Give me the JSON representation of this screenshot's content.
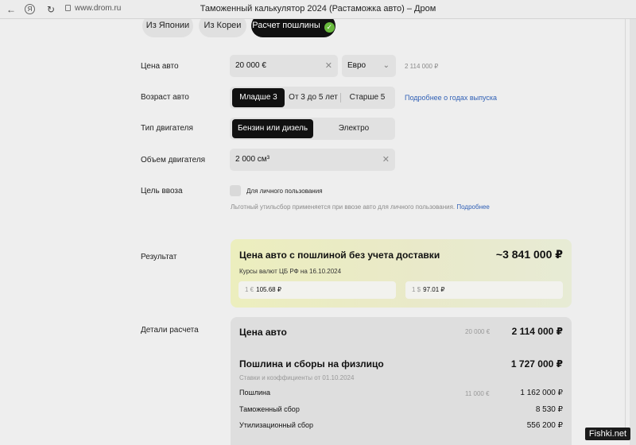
{
  "browser": {
    "url": "www.drom.ru",
    "title": "Таможенный калькулятор 2024 (Растаможка авто) – Дром"
  },
  "tabs": [
    {
      "label": "Из Японии"
    },
    {
      "label": "Из Кореи"
    },
    {
      "label": "Расчет пошлины"
    }
  ],
  "price": {
    "label": "Цена авто",
    "value": "20 000 €",
    "currency": "Евро",
    "converted": "2 114 000 ₽"
  },
  "age": {
    "label": "Возраст авто",
    "options": [
      "Младше 3",
      "От 3 до 5 лет",
      "Старше 5"
    ],
    "selected": "Младше 3",
    "link": "Подробнее о годах выпуска"
  },
  "engine": {
    "label": "Тип двигателя",
    "options": [
      "Бензин или дизель",
      "Электро"
    ],
    "selected": "Бензин или дизель"
  },
  "volume": {
    "label": "Объем двигателя",
    "value": "2 000 см³"
  },
  "purpose": {
    "label": "Цель ввоза",
    "checkbox": "Для личного пользования",
    "checked": false,
    "note": "Льготный утильсбор применяется при ввозе авто для личного пользования.",
    "note_link": "Подробнее"
  },
  "result": {
    "label": "Результат",
    "title": "Цена авто с пошлиной без учета доставки",
    "total": "~3 841 000 ₽",
    "rates_note": "Курсы валют ЦБ РФ на 16.10.2024",
    "eur_prefix": "1 €",
    "eur_rate": "105.68 ₽",
    "usd_prefix": "1 $",
    "usd_rate": "97.01 ₽"
  },
  "details": {
    "label": "Детали расчета",
    "car_price_title": "Цена авто",
    "car_price_eur": "20 000 €",
    "car_price_rub": "2 114 000 ₽",
    "duties_title": "Пошлина и сборы на физлицо",
    "duties_total": "1 727 000 ₽",
    "rates_date": "Ставки и коэффициенты от 01.10.2024",
    "rows": [
      {
        "label": "Пошлина",
        "eur": "11 000 €",
        "value": "1 162 000 ₽"
      },
      {
        "label": "Таможенный сбор",
        "eur": "",
        "value": "8 530 ₽"
      },
      {
        "label": "Утилизационный сбор",
        "eur": "",
        "value": "556 200 ₽"
      }
    ]
  },
  "watermark": "Fishki.net",
  "colors": {
    "accent": "#111111",
    "link": "#2f5fb5",
    "check": "#68b93c"
  },
  "icons": [
    "back-arrow-icon",
    "yandex-logo-icon",
    "reload-icon",
    "lock-icon",
    "clear-icon",
    "chevron-down-icon",
    "check-icon"
  ]
}
